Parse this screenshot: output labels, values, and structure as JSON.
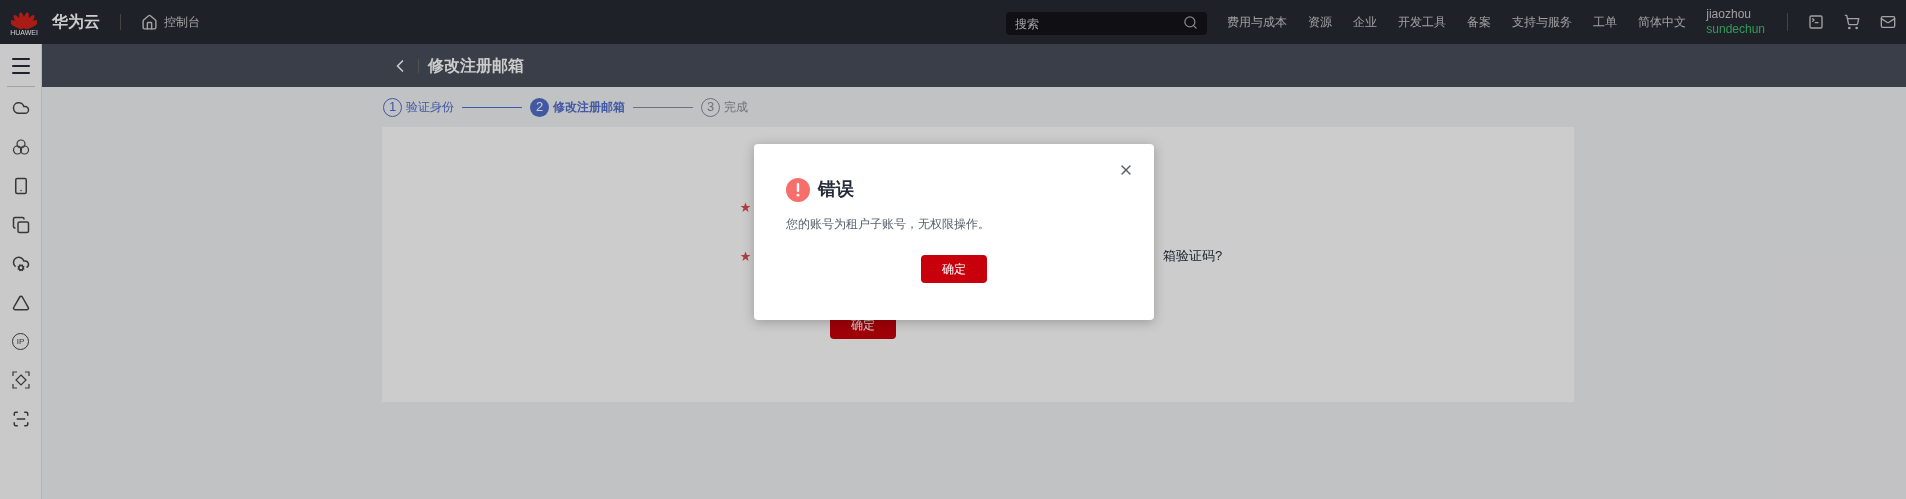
{
  "top_bar": {
    "logo": "HUAWEI",
    "brand": "华为云",
    "console": "控制台",
    "search": {
      "placeholder": "搜索"
    },
    "menu": [
      "费用与成本",
      "资源",
      "企业",
      "开发工具",
      "备案",
      "支持与服务",
      "工单",
      "简体中文"
    ],
    "user": {
      "account": "jiaozhou",
      "name": "sundechun"
    }
  },
  "sidebar": {
    "ip_label": "IP"
  },
  "page": {
    "title": "修改注册邮箱",
    "steps": [
      {
        "number": "1",
        "label": "验证身份",
        "done": true,
        "selected": false
      },
      {
        "number": "2",
        "label": "修改注册邮箱",
        "done": false,
        "selected": true
      },
      {
        "number": "3",
        "label": "完成",
        "done": false,
        "selected": false
      }
    ]
  },
  "form": {
    "fields": [
      {
        "required": true
      },
      {
        "required": true,
        "link": "箱验证码?"
      }
    ],
    "submit": "确定"
  },
  "dialog": {
    "kind": "error",
    "title": "错误",
    "message": "您的账号为租户子账号，无权限操作。",
    "button": "确定"
  }
}
